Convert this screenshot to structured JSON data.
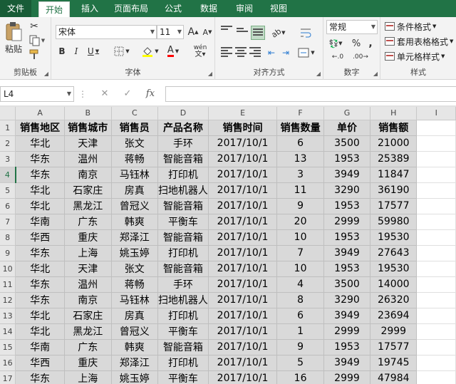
{
  "tabs": [
    "文件",
    "开始",
    "插入",
    "页面布局",
    "公式",
    "数据",
    "审阅",
    "视图"
  ],
  "active_tab": 1,
  "colors": {
    "accent": "#217346",
    "cell_fill": "#d9d9d9"
  },
  "ribbon": {
    "clipboard": {
      "label": "剪贴板",
      "paste_label": "粘贴",
      "icons": [
        "paste-icon",
        "cut-icon",
        "copy-icon",
        "format-painter-icon"
      ]
    },
    "font": {
      "label": "字体",
      "font_name": "宋体",
      "font_size": "11",
      "grow": "A",
      "shrink": "A",
      "bold": "B",
      "italic": "I",
      "underline": "U",
      "font_color": "A",
      "phonetic": "wén"
    },
    "alignment": {
      "label": "对齐方式"
    },
    "number": {
      "label": "数字",
      "format": "常规",
      "percent": "%",
      "comma": ","
    },
    "styles": {
      "label": "样式",
      "items": [
        "条件格式",
        "套用表格格式",
        "单元格样式"
      ]
    }
  },
  "formula_bar": {
    "name_box": "L4",
    "cancel": "✕",
    "confirm": "✓",
    "fx": "fx",
    "value": ""
  },
  "grid": {
    "columns": [
      "A",
      "B",
      "C",
      "D",
      "E",
      "F",
      "G",
      "H",
      "I"
    ],
    "headers": [
      "销售地区",
      "销售城市",
      "销售员",
      "产品名称",
      "销售时间",
      "销售数量",
      "单价",
      "销售额"
    ],
    "active_row": 4,
    "rows": [
      [
        "华北",
        "天津",
        "张文",
        "手环",
        "2017/10/1",
        "6",
        "3500",
        "21000"
      ],
      [
        "华东",
        "温州",
        "蒋畅",
        "智能音箱",
        "2017/10/1",
        "13",
        "1953",
        "25389"
      ],
      [
        "华东",
        "南京",
        "马钰林",
        "打印机",
        "2017/10/1",
        "3",
        "3949",
        "11847"
      ],
      [
        "华北",
        "石家庄",
        "房真",
        "扫地机器人",
        "2017/10/1",
        "11",
        "3290",
        "36190"
      ],
      [
        "华北",
        "黑龙江",
        "曾冠义",
        "智能音箱",
        "2017/10/1",
        "9",
        "1953",
        "17577"
      ],
      [
        "华南",
        "广东",
        "韩爽",
        "平衡车",
        "2017/10/1",
        "20",
        "2999",
        "59980"
      ],
      [
        "华西",
        "重庆",
        "郑泽江",
        "智能音箱",
        "2017/10/1",
        "10",
        "1953",
        "19530"
      ],
      [
        "华东",
        "上海",
        "姚玉婷",
        "打印机",
        "2017/10/1",
        "7",
        "3949",
        "27643"
      ],
      [
        "华北",
        "天津",
        "张文",
        "智能音箱",
        "2017/10/1",
        "10",
        "1953",
        "19530"
      ],
      [
        "华东",
        "温州",
        "蒋畅",
        "手环",
        "2017/10/1",
        "4",
        "3500",
        "14000"
      ],
      [
        "华东",
        "南京",
        "马钰林",
        "扫地机器人",
        "2017/10/1",
        "8",
        "3290",
        "26320"
      ],
      [
        "华北",
        "石家庄",
        "房真",
        "打印机",
        "2017/10/1",
        "6",
        "3949",
        "23694"
      ],
      [
        "华北",
        "黑龙江",
        "曾冠义",
        "平衡车",
        "2017/10/1",
        "1",
        "2999",
        "2999"
      ],
      [
        "华南",
        "广东",
        "韩爽",
        "智能音箱",
        "2017/10/1",
        "9",
        "1953",
        "17577"
      ],
      [
        "华西",
        "重庆",
        "郑泽江",
        "打印机",
        "2017/10/1",
        "5",
        "3949",
        "19745"
      ],
      [
        "华东",
        "上海",
        "姚玉婷",
        "平衡车",
        "2017/10/1",
        "16",
        "2999",
        "47984"
      ]
    ]
  }
}
